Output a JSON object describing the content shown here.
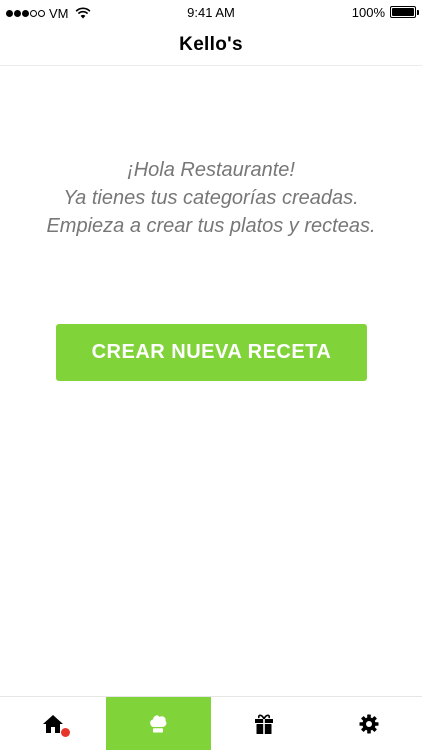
{
  "status_bar": {
    "carrier": "VM",
    "time": "9:41 AM",
    "battery": "100%"
  },
  "nav": {
    "title": "Kello's"
  },
  "welcome": {
    "line1": "¡Hola Restaurante!",
    "line2": "Ya tienes tus categorías creadas.",
    "line3": "Empieza a crear tus platos y recteas."
  },
  "cta": {
    "label": "CREAR NUEVA RECETA"
  },
  "tabs": [
    {
      "icon": "home-icon",
      "active": false,
      "badge": true
    },
    {
      "icon": "chef-hat-icon",
      "active": true,
      "badge": false
    },
    {
      "icon": "gift-icon",
      "active": false,
      "badge": false
    },
    {
      "icon": "gear-icon",
      "active": false,
      "badge": false
    }
  ],
  "colors": {
    "accent": "#80d43a",
    "badge": "#e8352c",
    "welcome_text": "#777777"
  }
}
